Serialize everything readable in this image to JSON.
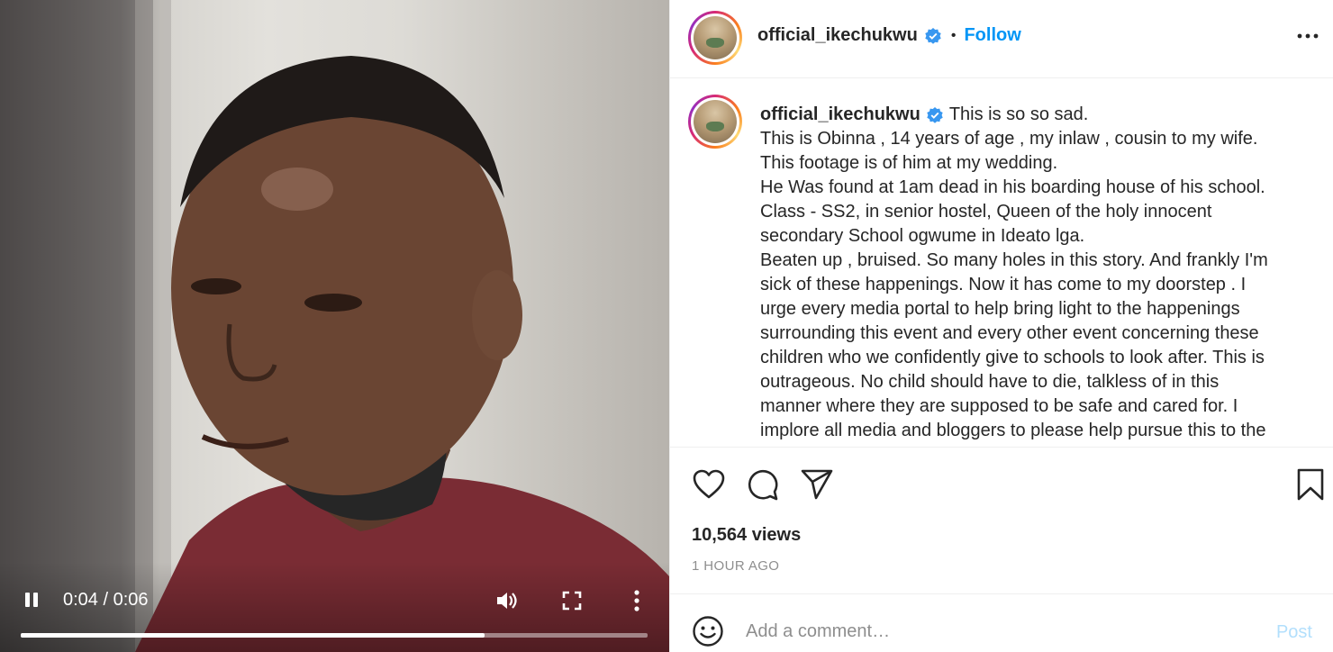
{
  "video": {
    "current_time": "0:04",
    "duration": "0:06",
    "time_display": "0:04 / 0:06",
    "progress": 0.74
  },
  "header": {
    "username": "official_ikechukwu",
    "separator": "•",
    "follow_label": "Follow"
  },
  "caption": {
    "username": "official_ikechukwu",
    "first_line": "This is so so sad.",
    "lines": [
      "This is Obinna , 14 years of age , my inlaw , cousin to my wife.",
      "This footage is of him at my wedding.",
      "He Was found at 1am dead in his boarding house of his school.",
      "Class - SS2, in senior hostel, Queen of the holy innocent",
      "secondary School ogwume in Ideato lga.",
      "Beaten up , bruised. So many holes in this story. And frankly I'm",
      "sick of these happenings. Now it has come to my doorstep . I",
      "urge every media portal to help bring light to the happenings",
      "surrounding this event and every other event concerning these",
      "children who we confidently give to schools to look after. This is",
      "outrageous. No child should have to die, talkless of in this",
      "manner where they are supposed to be safe and cared for. I",
      "implore all media and bloggers to please help pursue this to the"
    ]
  },
  "stats": {
    "views": "10,564 views",
    "time_ago": "1 HOUR AGO"
  },
  "comment": {
    "placeholder": "Add a comment…",
    "post_label": "Post"
  },
  "colors": {
    "accent": "#0095f6",
    "post_disabled": "#b2dffc",
    "verified": "#3897f0",
    "muted": "#8e8e8e"
  },
  "icons": [
    "pause-icon",
    "volume-icon",
    "fullscreen-icon",
    "more-vertical-icon",
    "verified-icon",
    "more-horizontal-icon",
    "heart-icon",
    "comment-icon",
    "share-icon",
    "bookmark-icon",
    "emoji-icon"
  ]
}
